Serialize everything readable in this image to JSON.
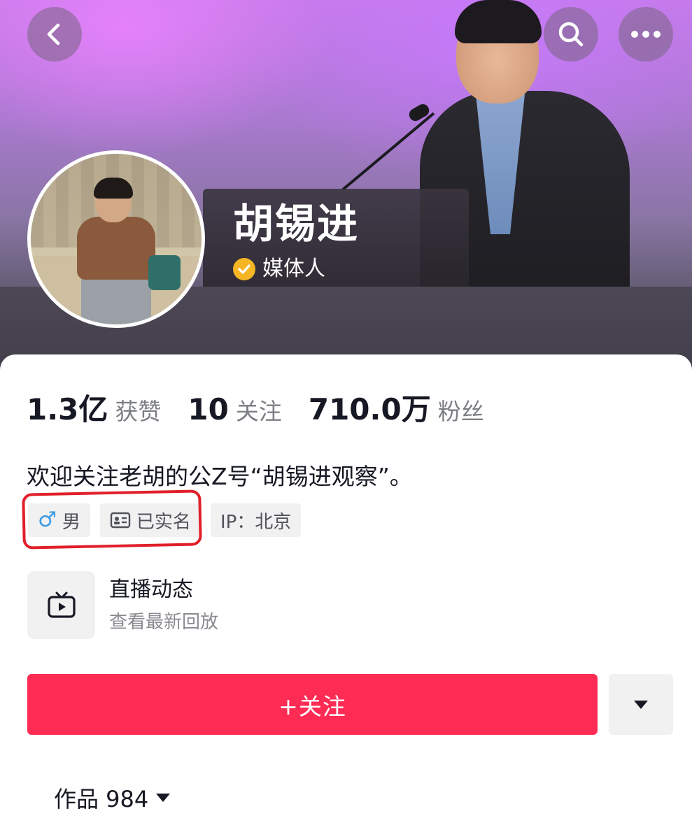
{
  "header": {
    "back_icon": "chevron-left-icon",
    "search_icon": "search-icon",
    "more_icon": "more-horizontal-icon"
  },
  "profile": {
    "name": "胡锡进",
    "verified_label": "媒体人",
    "verified_color": "#f6b623"
  },
  "stats": [
    {
      "value": "1.3亿",
      "label": "获赞"
    },
    {
      "value": "10",
      "label": "关注"
    },
    {
      "value": "710.0万",
      "label": "粉丝"
    }
  ],
  "bio": "欢迎关注老胡的公Z号“胡锡进观察”。",
  "tags": {
    "gender_symbol": "♂",
    "gender": "男",
    "realname": "已实名",
    "ip": "IP：北京"
  },
  "live": {
    "title": "直播动态",
    "subtitle": "查看最新回放"
  },
  "actions": {
    "follow_label": "+关注",
    "follow_color": "#fe2c55"
  },
  "works": {
    "label": "作品 984"
  }
}
